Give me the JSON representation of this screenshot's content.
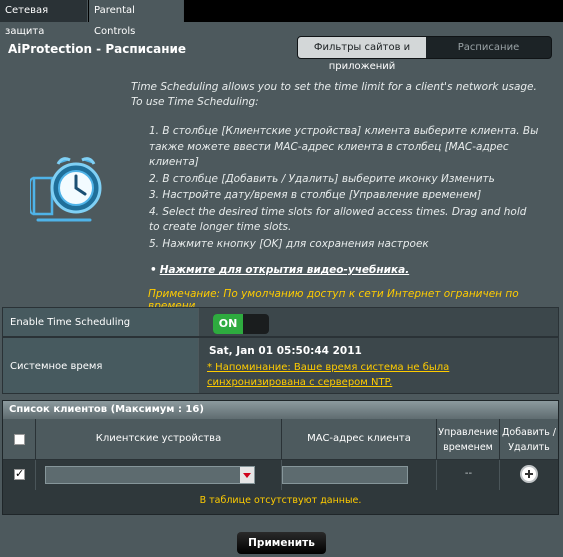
{
  "tabs": [
    {
      "label": "Сетевая защита"
    },
    {
      "label": "Parental Controls"
    }
  ],
  "page_title": "AiProtection - Расписание",
  "segment": {
    "option1_line1": "Фильтры сайтов и",
    "option1_line2": "приложений",
    "option2": "Расписание"
  },
  "intro": "Time Scheduling allows you to set the time limit for a client's network usage. To use Time Scheduling:",
  "steps": [
    "1. В столбце [Клиентские устройства] клиента выберите клиента. Вы также можете ввести MAC-адрес клиента в столбец [MAC-адрес клиента]",
    "2. В столбце [Добавить / Удалить] выберите иконку Изменить",
    "3. Настройте дату/время в столбце [Управление временем]",
    "4. Select the desired time slots for allowed access times. Drag and hold to create longer time slots.",
    "5. Нажмите кнопку [OK] для сохранения настроек"
  ],
  "video_link": "Нажмите для открытия видео-учебника.",
  "note": "Примечание: По умолчанию доступ к сети Интернет ограничен по времени.",
  "settings": {
    "enable_label": "Enable Time Scheduling",
    "toggle_state": "ON",
    "system_time_label": "Системное время",
    "system_time_value": "Sat, Jan 01 05:50:44 2011",
    "ntp_warning": "* Напоминание: Ваше время система не была синхронизирована с сервером NTP."
  },
  "client_list": {
    "header": "Список клиентов (Максимум : 16)",
    "columns": {
      "devices": "Клиентские устройства",
      "mac": "MAC-адрес клиента",
      "time_mgmt_line1": "Управление",
      "time_mgmt_line2": "временем",
      "add_delete_line1": "Добавить /",
      "add_delete_line2": "Удалить"
    },
    "row_time_value": "--",
    "empty_message": "В таблице отсутствуют данные."
  },
  "apply_button": "Применить",
  "colors": {
    "background": "#4d595d",
    "toggle_on": "#2eab3f",
    "warning_text": "#ffcc00",
    "accent_blue": "#4fb3e8"
  }
}
